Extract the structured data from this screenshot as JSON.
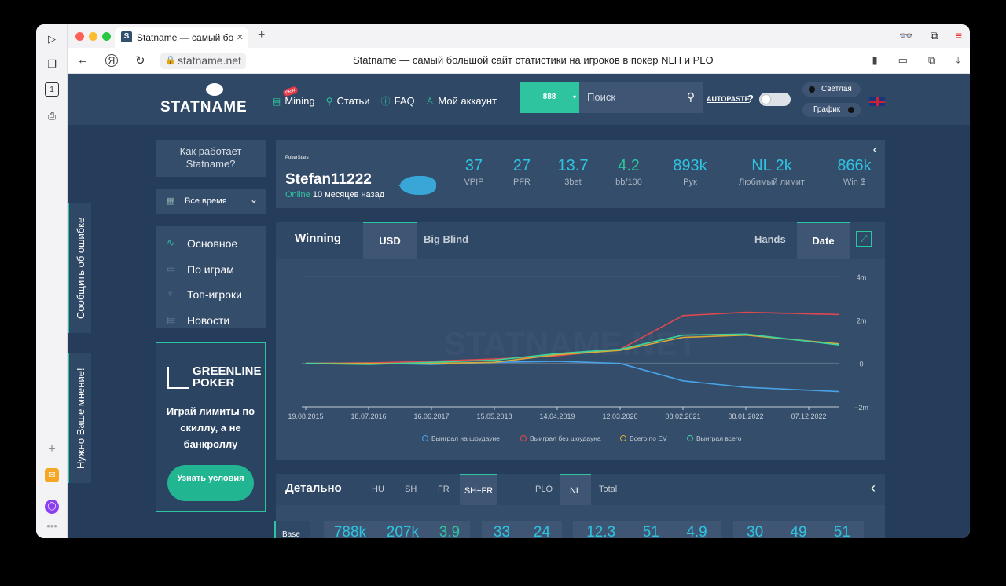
{
  "browser": {
    "tab_title": "Statname — самый бо",
    "favicon_letter": "S",
    "url": "statname.net",
    "page_title": "Statname — самый большой сайт статистики на игроков в покер NLH и PLO"
  },
  "header": {
    "logo_text": "STATNAME",
    "menu": [
      {
        "label": "Mining",
        "badge": "new"
      },
      {
        "label": "Статьи"
      },
      {
        "label": "FAQ"
      },
      {
        "label": "Мой аккаунт"
      }
    ],
    "room_selector": "888",
    "search_placeholder": "Поиск",
    "autopaste": "AUTOPASTE",
    "help": "?",
    "theme_label": "Светлая",
    "graph_label": "График"
  },
  "side_tabs": {
    "report_error": "Сообщить об ошибке",
    "feedback": "Нужно Ваше мнение!"
  },
  "left": {
    "how_it_works": "Как работает Statname?",
    "period": "Все время",
    "menu": [
      "Основное",
      "По играм",
      "Топ-игроки",
      "Новости"
    ],
    "ad": {
      "brand": "GREENLINE POKER",
      "text": "Играй лимиты по скиллу, а не банкроллу",
      "button": "Узнать условия"
    }
  },
  "player": {
    "room_logo": "PokerStars",
    "name": "Stefan11222",
    "online_label": "Online",
    "last_seen": "10 месяцев назад",
    "stats": [
      {
        "value": "37",
        "label": "VPIP"
      },
      {
        "value": "27",
        "label": "PFR"
      },
      {
        "value": "13.7",
        "label": "3bet"
      },
      {
        "value": "4.2",
        "label": "bb/100"
      },
      {
        "value": "893k",
        "label": "Рук"
      },
      {
        "value": "NL 2k",
        "label": "Любимый лимит"
      },
      {
        "value": "866k",
        "label": "Win $"
      }
    ]
  },
  "winning": {
    "title": "Winning",
    "tabs": [
      "USD",
      "Big Blind"
    ],
    "axis_tabs": [
      "Hands",
      "Date"
    ],
    "watermark": "STATNAME.NET"
  },
  "chart_data": {
    "type": "line",
    "x": [
      "19.08.2015",
      "18.07.2016",
      "16.06.2017",
      "15.05.2018",
      "14.04.2019",
      "12.03.2020",
      "08.02.2021",
      "08.01.2022",
      "07.12.2022"
    ],
    "y_ticks": [
      "4m",
      "2m",
      "0",
      "−2m"
    ],
    "ylim": [
      -2,
      4
    ],
    "series": [
      {
        "name": "Выиграл на шоудауне",
        "color": "#4aa3e6",
        "values": [
          0,
          0.02,
          -0.05,
          0.05,
          0.1,
          0,
          -0.8,
          -1.1,
          -1.3
        ]
      },
      {
        "name": "Выиграл без шоудауна",
        "color": "#e0484f",
        "values": [
          0,
          0.02,
          0.1,
          0.2,
          0.35,
          0.65,
          2.2,
          2.35,
          2.25
        ]
      },
      {
        "name": "Всего по EV",
        "color": "#d8a93a",
        "values": [
          0,
          0,
          0,
          0.05,
          0.4,
          0.6,
          1.2,
          1.3,
          0.9
        ]
      },
      {
        "name": "Выиграл всего",
        "color": "#3ed49c",
        "values": [
          0,
          -0.05,
          0.05,
          0.15,
          0.45,
          0.65,
          1.3,
          1.35,
          0.85
        ]
      }
    ]
  },
  "detail": {
    "title": "Детально",
    "tabs": [
      "HU",
      "SH",
      "FR",
      "SH+FR",
      "PLO",
      "NL",
      "Total"
    ],
    "row_label": "Base",
    "boxes": [
      [
        "788k",
        "207k",
        "3.9"
      ],
      [
        "33",
        "24"
      ],
      [
        "12.3",
        "51",
        "4.9"
      ],
      [
        "30",
        "49",
        "51"
      ]
    ]
  }
}
